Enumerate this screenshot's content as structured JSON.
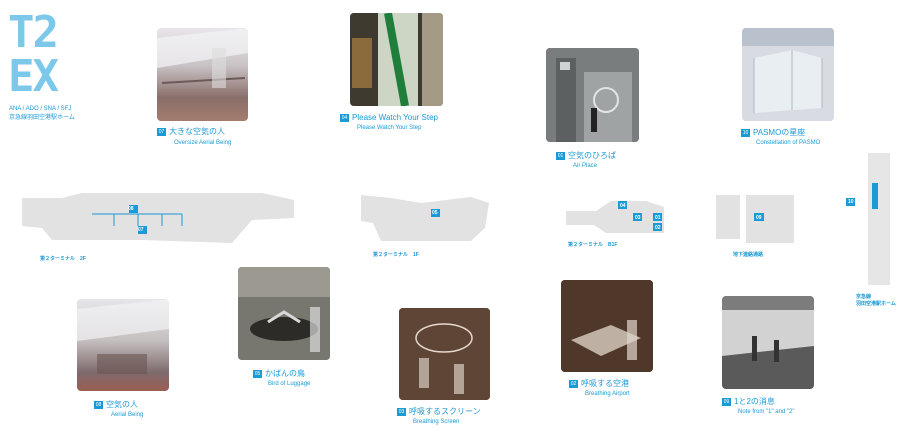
{
  "logo": {
    "line1": "T2",
    "line2": "EX",
    "airlines": "ANA / ADO / SNA / SFJ",
    "station": "京急線羽田空港駅ホーム"
  },
  "works": [
    {
      "num": "07",
      "title": "大きな空気の人",
      "subtitle": "Oversize Aerial Being"
    },
    {
      "num": "04",
      "title": "Please Watch Your Step",
      "subtitle": "Please Watch Your Step"
    },
    {
      "num": "01",
      "title": "空気のひろば",
      "subtitle": "Air Place"
    },
    {
      "num": "10",
      "title": "PASMOの星座",
      "subtitle": "Constellation of PASMO"
    },
    {
      "num": "08",
      "title": "空気の人",
      "subtitle": "Aerial Being"
    },
    {
      "num": "05",
      "title": "かばんの鳥",
      "subtitle": "Bird of Luggage"
    },
    {
      "num": "03",
      "title": "呼吸するスクリーン",
      "subtitle": "Breathing Screen"
    },
    {
      "num": "02",
      "title": "呼吸する空港",
      "subtitle": "Breathing Airport"
    },
    {
      "num": "09",
      "title": "1と2の消息",
      "subtitle": "Note from \"1\" and \"2\""
    }
  ],
  "maps": {
    "floor2f": {
      "label": "第２ターミナル　2F",
      "markers": [
        "08",
        "07"
      ]
    },
    "floor1f": {
      "label": "第２ターミナル　1F",
      "markers": [
        "05"
      ]
    },
    "floorb1": {
      "label": "第２ターミナル　B1F",
      "markers": [
        "04",
        "03",
        "01",
        "02"
      ]
    },
    "passage": {
      "label": "地下連絡通路",
      "markers": [
        "09"
      ]
    },
    "station": {
      "label": "京急線\n羽田空港駅ホーム",
      "markers": [
        "10"
      ]
    }
  }
}
